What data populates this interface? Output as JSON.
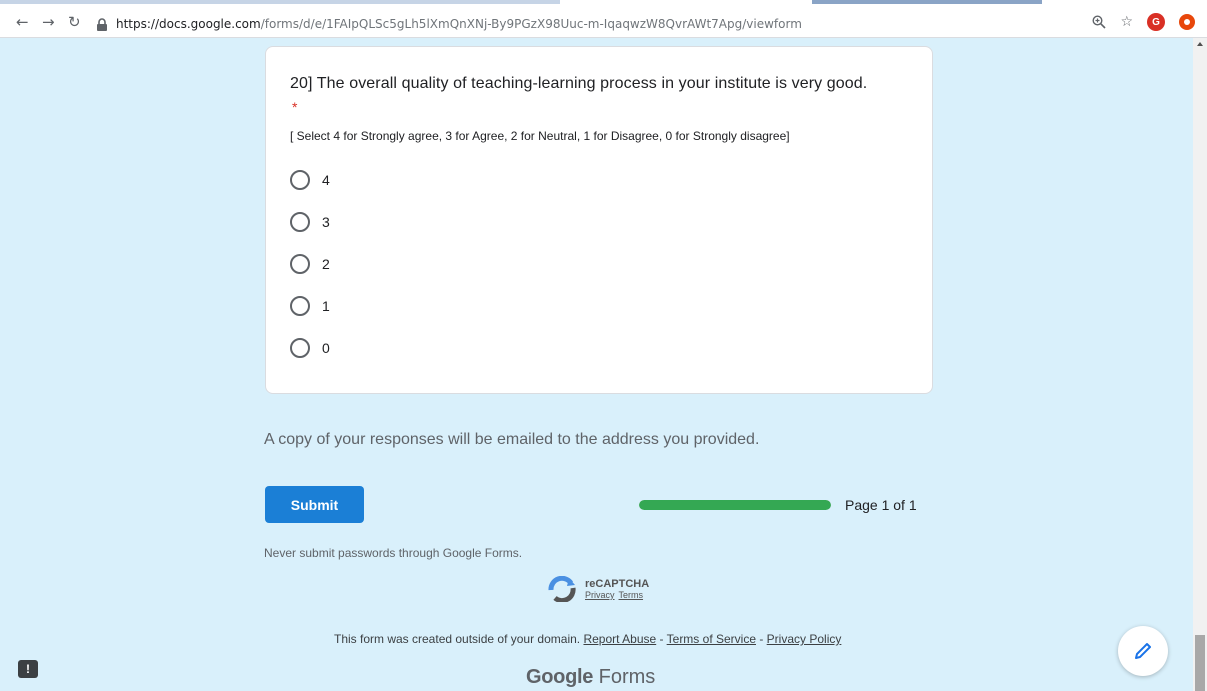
{
  "browser": {
    "url_host": "https://docs.google.com",
    "url_path": "/forms/d/e/1FAIpQLSc5gLh5lXmQnXNj-By9PGzX98Uuc-m-IqaqwzW8QvrAWt7Apg/viewform",
    "avatar_letter": "G",
    "icons": [
      "back-icon",
      "forward-icon",
      "reload-icon",
      "lock-icon",
      "zoom-icon",
      "star-icon",
      "avatar",
      "extension-icon"
    ]
  },
  "question": {
    "title": "20] The overall quality of teaching-learning process in your institute is very good.",
    "required_mark": "*",
    "description": "[ Select 4 for Strongly agree, 3 for Agree, 2 for Neutral, 1 for Disagree, 0 for Strongly disagree]",
    "options": [
      "4",
      "3",
      "2",
      "1",
      "0"
    ]
  },
  "notice": "A copy of your responses will be emailed to the address you provided.",
  "submit_label": "Submit",
  "progress": {
    "fraction": 1.0,
    "color": "#34a853",
    "label": "Page 1 of 1"
  },
  "warning": "Never submit passwords through Google Forms.",
  "recaptcha": {
    "title": "reCAPTCHA",
    "privacy": "Privacy",
    "terms": "Terms"
  },
  "footer": {
    "text": "This form was created outside of your domain.",
    "report_abuse": "Report Abuse",
    "sep1": " - ",
    "terms_of_service": "Terms of Service",
    "sep2": " - ",
    "privacy_policy": "Privacy Policy"
  },
  "brand": {
    "google": "Google",
    "forms": " Forms"
  },
  "colors": {
    "page_bg": "#d9f0fb",
    "submit_bg": "#1b7fd6",
    "required": "#d93025"
  }
}
